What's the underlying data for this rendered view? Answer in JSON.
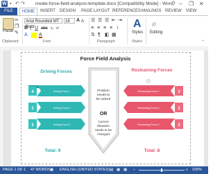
{
  "window": {
    "title": "create-force-field-analysis-template.docx [Compatibility Mode] - Word",
    "help_label": "?",
    "minimize": "–",
    "maximize": "❐",
    "close": "✕"
  },
  "tabs": [
    {
      "label": "FILE"
    },
    {
      "label": "HOME"
    },
    {
      "label": "INSERT"
    },
    {
      "label": "DESIGN"
    },
    {
      "label": "PAGE LAYOUT"
    },
    {
      "label": "REFERENCES"
    },
    {
      "label": "MAILINGS"
    },
    {
      "label": "REVIEW"
    },
    {
      "label": "VIEW"
    }
  ],
  "ribbon": {
    "paste_label": "Paste",
    "font_name": "Arial Rounded MT Bold",
    "font_size": "16",
    "styles_label": "Styles",
    "editing_label": "Editing",
    "groups": {
      "clipboard": "Clipboard",
      "font": "Font",
      "paragraph": "Paragraph",
      "styles": "Styles"
    }
  },
  "diagram": {
    "title": "Force Field Analysis",
    "left_heading": "Driving Forces",
    "right_heading": "Restraining Forces",
    "left_items": [
      {
        "num": "4",
        "label": "Driving Force 1"
      },
      {
        "num": "3",
        "label": "Driving Force 2"
      },
      {
        "num": "2",
        "label": "Driving Force 3"
      }
    ],
    "right_items": [
      {
        "num": "3",
        "label": "Restraining Force 1"
      },
      {
        "num": "2",
        "label": "Restraining Force 2"
      },
      {
        "num": "3",
        "label": "Restraining Force 3"
      }
    ],
    "center_top": "Problem needs to be solved",
    "center_or": "OR",
    "center_bottom": "Current Situation needs to be changed",
    "left_total": "Total: 9",
    "right_total": "Total: 8",
    "colors": {
      "driving": "#2fb7b4",
      "restraining": "#e8566c",
      "center": "#d0d0d0",
      "heading_left": "#2aa8a8",
      "heading_right": "#e84d6a"
    }
  },
  "status": {
    "page": "PAGE 1 OF 1",
    "words": "47 WORDS",
    "language": "ENGLISH (UNITED STATES)",
    "zoom": "100%"
  }
}
